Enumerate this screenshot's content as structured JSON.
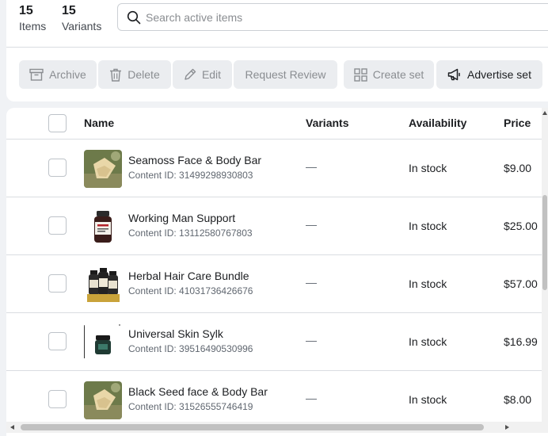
{
  "summary": {
    "items_count": "15",
    "items_label": "Items",
    "variants_count": "15",
    "variants_label": "Variants"
  },
  "search": {
    "placeholder": "Search active items",
    "value": ""
  },
  "toolbar": {
    "archive_label": "Archive",
    "delete_label": "Delete",
    "edit_label": "Edit",
    "request_review_label": "Request Review",
    "create_set_label": "Create set",
    "advertise_set_label": "Advertise set"
  },
  "table": {
    "headers": {
      "name": "Name",
      "variants": "Variants",
      "availability": "Availability",
      "price": "Price"
    },
    "rows": [
      {
        "name": "Seamoss Face & Body Bar",
        "content_id": "Content ID: 31499298930803",
        "variants": "—",
        "availability": "In stock",
        "price": "$9.00",
        "thumb": "soap-bar-photo"
      },
      {
        "name": "Working Man Support",
        "content_id": "Content ID: 13112580767803",
        "variants": "—",
        "availability": "In stock",
        "price": "$25.00",
        "thumb": "supplement-bottle"
      },
      {
        "name": "Herbal Hair Care Bundle",
        "content_id": "Content ID: 41031736426676",
        "variants": "—",
        "availability": "In stock",
        "price": "$57.00",
        "thumb": "hair-bundle-bottles"
      },
      {
        "name": "Universal Skin Sylk",
        "content_id": "Content ID: 39516490530996",
        "variants": "—",
        "availability": "In stock",
        "price": "$16.99",
        "thumb": "skin-jar"
      },
      {
        "name": "Black Seed face & Body Bar",
        "content_id": "Content ID: 31526555746419",
        "variants": "—",
        "availability": "In stock",
        "price": "$8.00",
        "thumb": "soap-bar-photo"
      }
    ]
  },
  "colors": {
    "background": "#f0f2f5",
    "disabled_button": "#ebedf0",
    "border": "#dadde1"
  }
}
